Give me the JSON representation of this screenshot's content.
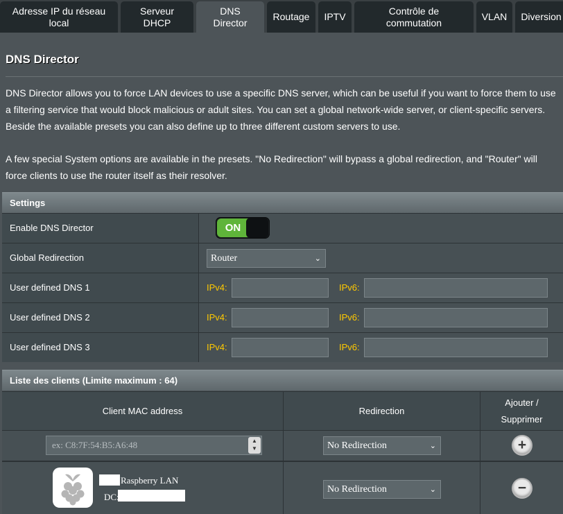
{
  "tabs": [
    {
      "label": "Adresse IP du réseau\nlocal",
      "active": false
    },
    {
      "label": "Serveur\nDHCP",
      "active": false
    },
    {
      "label": "DNS\nDirector",
      "active": true
    },
    {
      "label": "Routage",
      "active": false
    },
    {
      "label": "IPTV",
      "active": false
    },
    {
      "label": "Contrôle de\ncommutation",
      "active": false
    },
    {
      "label": "VLAN",
      "active": false
    },
    {
      "label": "Diversion",
      "active": false
    }
  ],
  "page": {
    "title": "DNS Director",
    "desc1": "DNS Director allows you to force LAN devices to use a specific DNS server, which can be useful if you want to force them to use",
    "desc2": "a filtering service that would block malicious or adult sites. You can set a global network-wide server, or client-specific servers.",
    "desc3": "Beside the available presets you can also define up to three different custom servers to use.",
    "desc4": "A few special System options are available in the presets. \"No Redirection\" will bypass a global redirection, and \"Router\" will",
    "desc5": "force clients to use the router itself as their resolver."
  },
  "settings": {
    "header": "Settings",
    "enable_label": "Enable DNS Director",
    "toggle_text": "ON",
    "global_label": "Global Redirection",
    "global_value": "Router",
    "dns1_label": "User defined DNS 1",
    "dns2_label": "User defined DNS 2",
    "dns3_label": "User defined DNS 3",
    "ipv4": "IPv4:",
    "ipv6": "IPv6:"
  },
  "clients": {
    "header": "Liste des clients (Limite maximum : 64)",
    "col_mac": "Client MAC address",
    "col_redirection": "Redirection",
    "col_action_1": "Ajouter /",
    "col_action_2": "Supprimer",
    "mac_placeholder": "ex: C8:7F:54:B5:A6:48",
    "new_redirection": "No Redirection",
    "entry": {
      "name": "Raspberry LAN",
      "dc_label": "DC:",
      "redirection": "No Redirection"
    }
  },
  "colors": {
    "accent_yellow": "#ffc900",
    "toggle_green": "#5fb43a",
    "background": "#4d5458"
  }
}
